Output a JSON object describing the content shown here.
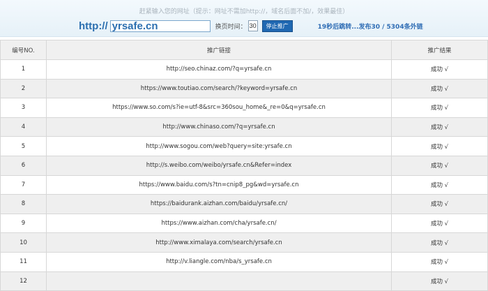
{
  "header": {
    "hint": "赶紧输入您的网址（提示：网址不需加http://，域名后面不加/，效果最佳）",
    "protocol": "http://",
    "url_value": "yrsafe.cn",
    "switch_label": "换页时间：",
    "interval_value": "30",
    "stop_button": "停止推广",
    "status": "19秒后跳转...发布30 / 5304条外链"
  },
  "table": {
    "headers": [
      "编号NO.",
      "推广链接",
      "推广结果"
    ],
    "rows": [
      {
        "no": "1",
        "link": "http://seo.chinaz.com/?q=yrsafe.cn",
        "result": "成功 √"
      },
      {
        "no": "2",
        "link": "https://www.toutiao.com/search/?keyword=yrsafe.cn",
        "result": "成功 √"
      },
      {
        "no": "3",
        "link": "https://www.so.com/s?ie=utf-8&src=360sou_home&_re=0&q=yrsafe.cn",
        "result": "成功 √"
      },
      {
        "no": "4",
        "link": "http://www.chinaso.com/?q=yrsafe.cn",
        "result": "成功 √"
      },
      {
        "no": "5",
        "link": "http://www.sogou.com/web?query=site:yrsafe.cn",
        "result": "成功 √"
      },
      {
        "no": "6",
        "link": "http://s.weibo.com/weibo/yrsafe.cn&Refer=index",
        "result": "成功 √"
      },
      {
        "no": "7",
        "link": "https://www.baidu.com/s?tn=cnip8_pg&wd=yrsafe.cn",
        "result": "成功 √"
      },
      {
        "no": "8",
        "link": "https://baidurank.aizhan.com/baidu/yrsafe.cn/",
        "result": "成功 √"
      },
      {
        "no": "9",
        "link": "https://www.aizhan.com/cha/yrsafe.cn/",
        "result": "成功 √"
      },
      {
        "no": "10",
        "link": "http://www.ximalaya.com/search/yrsafe.cn",
        "result": "成功 √"
      },
      {
        "no": "11",
        "link": "http://v.liangle.com/nba/s_yrsafe.cn",
        "result": "成功 √"
      },
      {
        "no": "12",
        "link": "",
        "result": "成功 √"
      }
    ]
  }
}
